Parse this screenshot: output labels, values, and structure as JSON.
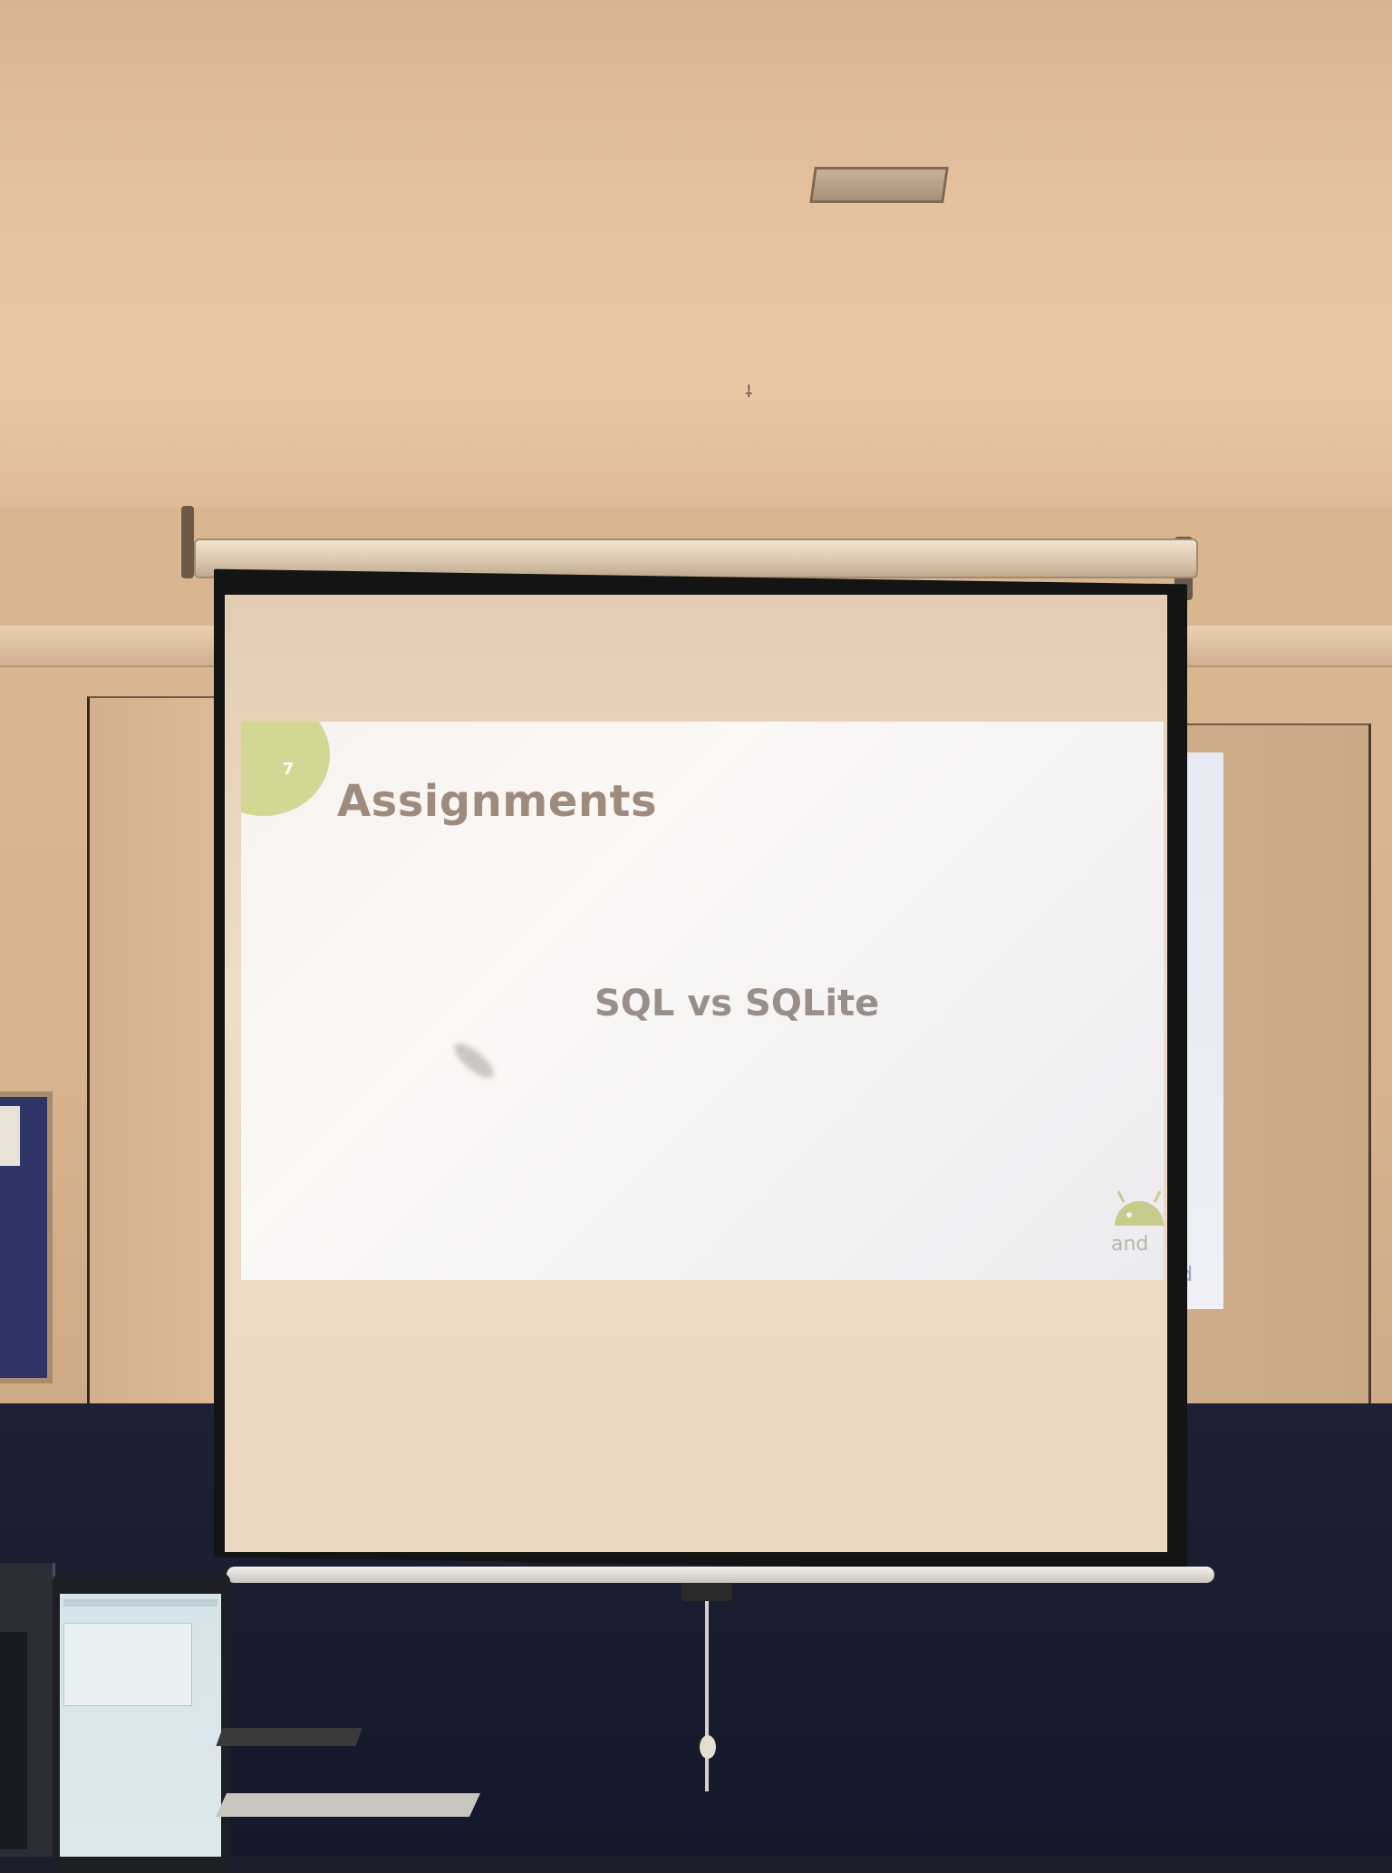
{
  "slide": {
    "number": "7",
    "title": "Assignments",
    "body": "SQL vs SQLite",
    "logo_text": "and",
    "spill_text": "id"
  },
  "colors": {
    "ceiling": "#e4c29f",
    "wall": "#d7b48e",
    "screen_frame": "#141414",
    "slide_bg": "#f6f2ef",
    "title_text": "#9f8b7d",
    "accent_circle": "#cfd48a",
    "android_green": "#c6cc8a",
    "lower_wall": "#1d2133"
  },
  "icons": {
    "android_logo": "android-logo-icon",
    "ceiling_vent": "vent-icon"
  }
}
